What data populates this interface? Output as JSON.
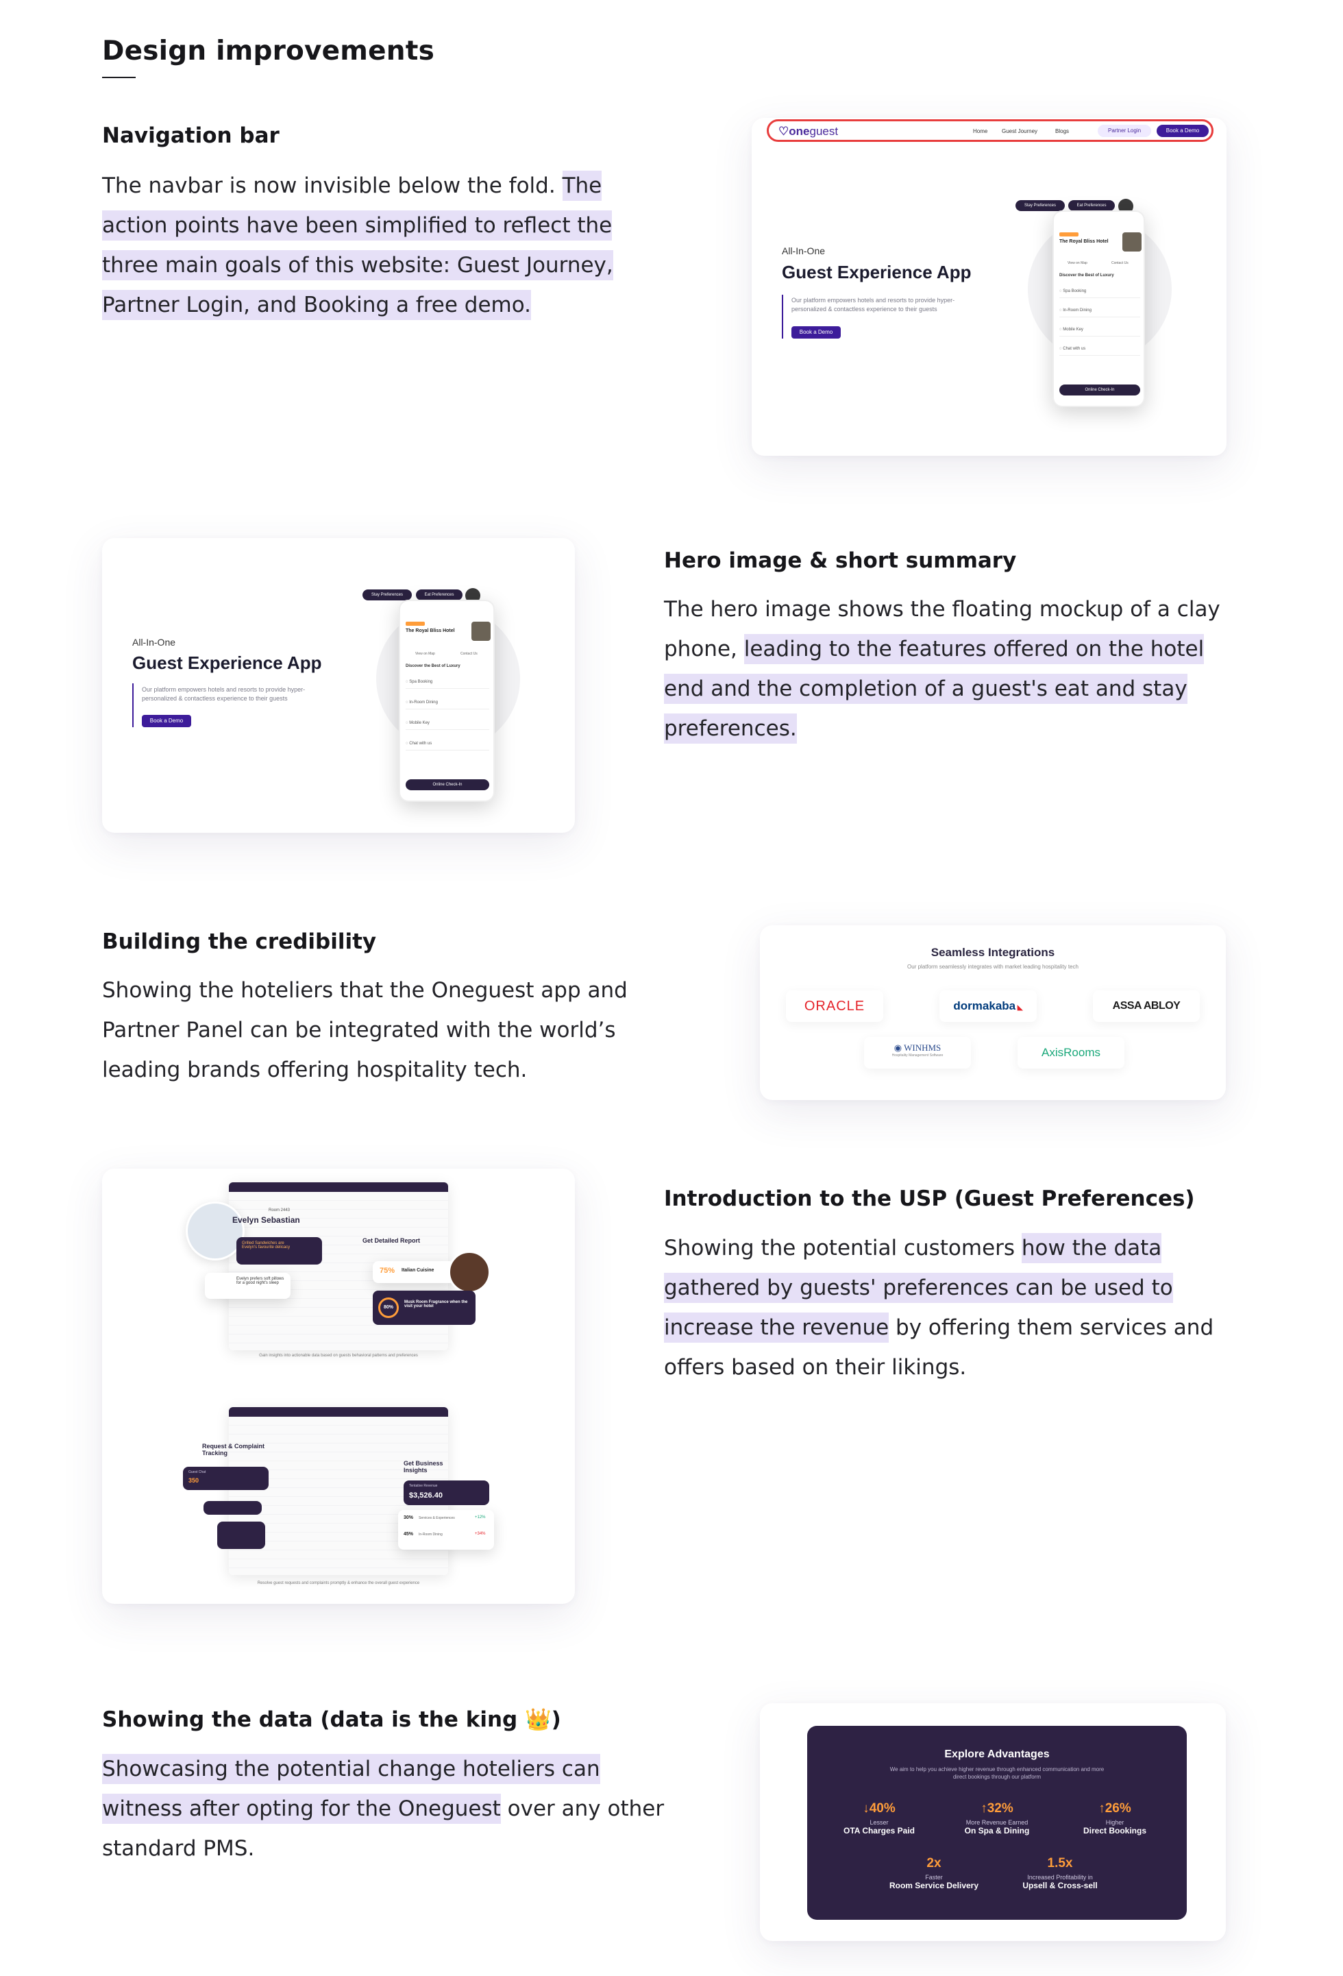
{
  "page_title": "Design improvements",
  "sections": {
    "navbar": {
      "heading": "Navigation bar",
      "text_plain": "The navbar is now invisible below the fold. ",
      "text_highlight": "The action points have been simplified to reflect the three main goals of this website: Guest Journey, Partner Login, and Booking a free demo."
    },
    "hero": {
      "heading": "Hero image & short summary",
      "text_plain": "The hero image shows the floating mockup of a clay phone, ",
      "text_highlight": "leading to the features offered on the hotel end and the completion of a guest's eat and stay preferences."
    },
    "credibility": {
      "heading": "Building the credibility",
      "text_plain": "Showing the hoteliers that the Oneguest app and Partner Panel can be integrated with the world’s leading brands offering hospitality tech."
    },
    "usp": {
      "heading": "Introduction to the USP (Guest Preferences)",
      "text_before": "Showing the potential customers ",
      "text_highlight": "how the data gathered by guests' preferences can be used to increase the revenue",
      "text_after": " by offering them services and offers based on their likings."
    },
    "data": {
      "heading": "Showing the data (data is the king 👑)",
      "text_highlight": "Showcasing the potential change hoteliers can witness after opting for the Oneguest",
      "text_after": " over any other standard PMS."
    }
  },
  "mock_navbar": {
    "logo_bold": "one",
    "logo_rest": "guest",
    "links": [
      "Home",
      "Guest Journey",
      "Blogs"
    ],
    "partner_login": "Partner Login",
    "book_demo": "Book a Demo"
  },
  "mock_hero": {
    "kicker": "All-In-One",
    "title": "Guest Experience App",
    "desc": "Our platform empowers hotels and resorts to provide hyper-personalized & contactless experience to their guests",
    "button": "Book a Demo",
    "pill1": "Stay Preferences",
    "pill2": "Eat Preferences",
    "hotel_name": "The Royal Bliss Hotel",
    "discover": "Discover the Best of Luxury",
    "list": [
      "Spa Booking",
      "In-Room Dining",
      "Mobile Key",
      "Chat with us"
    ],
    "checkin": "Online Check-In",
    "tabs": [
      "View on Map",
      "Contact Us"
    ]
  },
  "integrations": {
    "title": "Seamless Integrations",
    "subtitle": "Our platform seamlessly integrates with market leading hospitality tech",
    "logos": [
      "ORACLE",
      "dormakaba",
      "ASSA ABLOY",
      "WINHMS",
      "AxisRooms"
    ],
    "winhms_sub": "Hospitality Management Software"
  },
  "usp_mock": {
    "guest_name": "Evelyn Sebastian",
    "room": "Room 2443",
    "chip1": "Grilled Sandwiches are Evelyn's favourite delicacy",
    "chip2": "Evelyn prefers soft pillows for a good night's sleep",
    "report_title": "Get Detailed Report",
    "cuisine_pct": "75%",
    "cuisine_label": "Italian Cuisine",
    "musk_pct": "80%",
    "musk_label": "Musk Room Fragrance when the visit your hotel",
    "caption1": "Gain insights into actionable data based on guests behavioral patterns and preferences",
    "request_title": "Request & Complaint Tracking",
    "req_total": "350",
    "req_label": "Guest Chat",
    "insights_title": "Get Business Insights",
    "rev_label": "Tentative Revenue",
    "rev_value": "$3,526.40",
    "stat1_pct": "30%",
    "stat1_label": "Services & Experiences",
    "stat1_delta": "+12%",
    "stat2_pct": "45%",
    "stat2_label": "In-Room Dining",
    "stat2_delta": "+34%",
    "caption2": "Resolve guest requests and complaints promptly & enhance the overall guest experience"
  },
  "advantages": {
    "title": "Explore Advantages",
    "subtitle": "We aim to help you achieve higher revenue through enhanced communication and more direct bookings through our platform",
    "items": [
      {
        "value": "↓40%",
        "sub": "Lesser",
        "label": "OTA Charges Paid"
      },
      {
        "value": "↑32%",
        "sub": "More Revenue Earned",
        "label": "On Spa & Dining"
      },
      {
        "value": "↑26%",
        "sub": "Higher",
        "label": "Direct Bookings"
      },
      {
        "value": "2x",
        "sub": "Faster",
        "label": "Room Service Delivery"
      },
      {
        "value": "1.5x",
        "sub": "Increased Profitability in",
        "label": "Upsell & Cross-sell"
      }
    ]
  },
  "colors": {
    "highlight": "#e6e0f7",
    "brand_purple": "#3d1c9a",
    "dark_panel": "#2e2244",
    "accent_orange": "#ff9d3a",
    "navbar_outline": "#e83d3d"
  }
}
